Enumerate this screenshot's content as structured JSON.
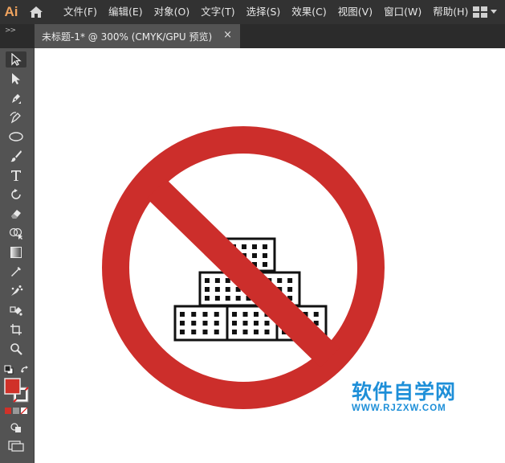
{
  "app": {
    "logo_text": "Ai"
  },
  "menu": {
    "items": [
      "文件(F)",
      "编辑(E)",
      "对象(O)",
      "文字(T)",
      "选择(S)",
      "效果(C)",
      "视图(V)",
      "窗口(W)",
      "帮助(H)"
    ]
  },
  "tabs": {
    "collapse": ">>",
    "doc_title": "未标题-1* @ 300% (CMYK/GPU 预览)",
    "close": "×"
  },
  "tools": [
    "selection",
    "direct-selection",
    "pen",
    "curvature",
    "ellipse",
    "paintbrush",
    "type",
    "rotate",
    "eraser",
    "shape-builder",
    "gradient",
    "eyedropper",
    "symbol-sprayer",
    "live-paint",
    "artboard",
    "zoom"
  ],
  "colors": {
    "fill": "#d03129",
    "sign_red": "#cc2e2b",
    "watermark": "#1e8fd8"
  },
  "watermark": {
    "cn": "软件自学网",
    "url": "WWW.RJZXW.COM"
  }
}
